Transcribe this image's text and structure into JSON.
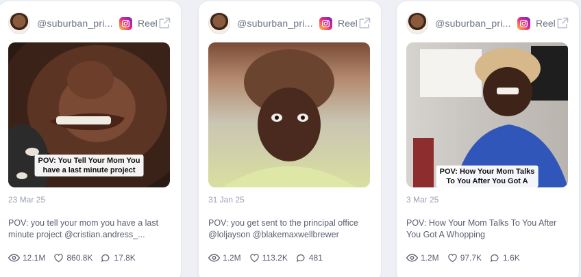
{
  "cards": [
    {
      "handle": "@suburban_pri...",
      "type_label": "Reel",
      "overlay_line1": "POV: You Tell Your Mom You",
      "overlay_line2": "have a last minute project",
      "date": "23 Mar 25",
      "description": "POV: you tell your mom you have a last minute project @cristian.andress_...",
      "views": "12.1M",
      "likes": "860.8K",
      "comments": "17.8K"
    },
    {
      "handle": "@suburban_pri...",
      "type_label": "Reel",
      "overlay_line1": "",
      "overlay_line2": "",
      "date": "31 Jan 25",
      "description": "POV: you get sent to the principal office @loljayson @blakemaxwellbrewer",
      "views": "1.2M",
      "likes": "113.2K",
      "comments": "481"
    },
    {
      "handle": "@suburban_pri...",
      "type_label": "Reel",
      "overlay_line1": "POV: How Your Mom Talks",
      "overlay_line2": "To You After You Got A",
      "date": "3 Mar 25",
      "description": "POV: How Your Mom Talks To You After You Got A Whopping",
      "views": "1.2M",
      "likes": "97.7K",
      "comments": "1.6K"
    }
  ],
  "icons": {
    "platform": "instagram-icon",
    "external": "external-link-icon",
    "views": "eye-icon",
    "likes": "heart-icon",
    "comments": "comment-icon"
  },
  "colors": {
    "text_muted": "#6b7280",
    "text_body": "#5b6170",
    "date": "#9aa0ad",
    "background": "#eef0f5"
  }
}
